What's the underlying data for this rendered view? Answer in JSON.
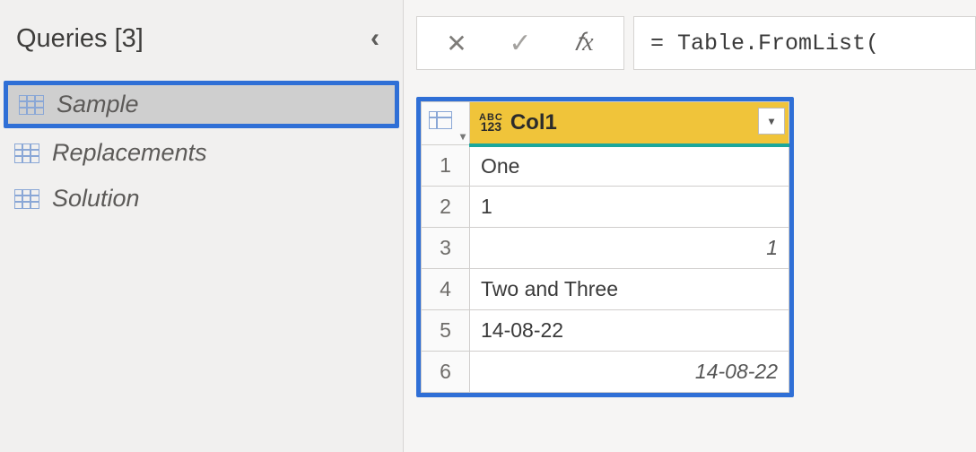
{
  "sidebar": {
    "title": "Queries [3]",
    "items": [
      {
        "label": "Sample",
        "selected": true
      },
      {
        "label": "Replacements",
        "selected": false
      },
      {
        "label": "Solution",
        "selected": false
      }
    ]
  },
  "formula_bar": {
    "value": "= Table.FromList("
  },
  "table": {
    "column_header": "Col1",
    "type_badge": {
      "top": "ABC",
      "bottom": "123"
    },
    "rows": [
      {
        "index": "1",
        "value": "One",
        "align": "left"
      },
      {
        "index": "2",
        "value": "1",
        "align": "left"
      },
      {
        "index": "3",
        "value": "1",
        "align": "right-italic"
      },
      {
        "index": "4",
        "value": "Two and Three",
        "align": "left"
      },
      {
        "index": "5",
        "value": "14-08-22",
        "align": "left"
      },
      {
        "index": "6",
        "value": "14-08-22",
        "align": "right-italic"
      }
    ]
  },
  "colors": {
    "highlight_border": "#2f6fd6",
    "column_header_bg": "#f0c43a",
    "teal_underline": "#1aa79c"
  }
}
